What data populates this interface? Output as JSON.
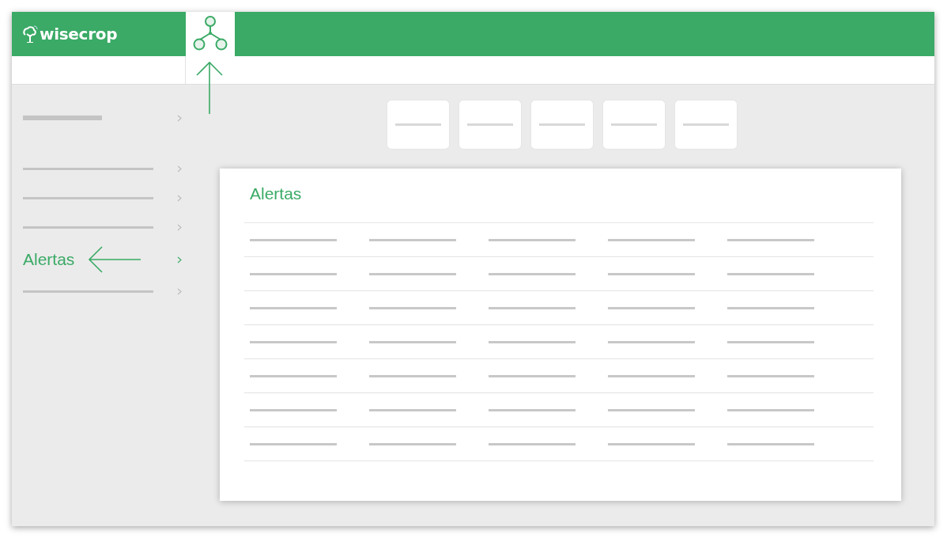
{
  "header": {
    "logo": "wisecrop",
    "app_icon": {
      "selected": true,
      "callout_arrow": true
    }
  },
  "sidebar": {
    "items": [
      {
        "kind": "heading",
        "selected": false
      },
      {
        "kind": "placeholder",
        "selected": false
      },
      {
        "kind": "placeholder",
        "selected": false
      },
      {
        "kind": "placeholder",
        "selected": false
      },
      {
        "kind": "label",
        "label": "Alertas",
        "selected": true,
        "callout_arrow": true
      },
      {
        "kind": "placeholder",
        "selected": false
      }
    ]
  },
  "cards": [
    {
      "kind": "placeholder"
    },
    {
      "kind": "placeholder"
    },
    {
      "kind": "placeholder"
    },
    {
      "kind": "placeholder"
    },
    {
      "kind": "placeholder"
    }
  ],
  "panel": {
    "title": "Alertas",
    "columns": [
      {
        "kind": "placeholder"
      },
      {
        "kind": "placeholder"
      },
      {
        "kind": "placeholder"
      },
      {
        "kind": "placeholder"
      },
      {
        "kind": "placeholder"
      }
    ],
    "rows": [
      {
        "kind": "placeholder"
      },
      {
        "kind": "placeholder"
      },
      {
        "kind": "placeholder"
      },
      {
        "kind": "placeholder"
      },
      {
        "kind": "placeholder"
      },
      {
        "kind": "placeholder"
      },
      {
        "kind": "placeholder"
      }
    ]
  }
}
